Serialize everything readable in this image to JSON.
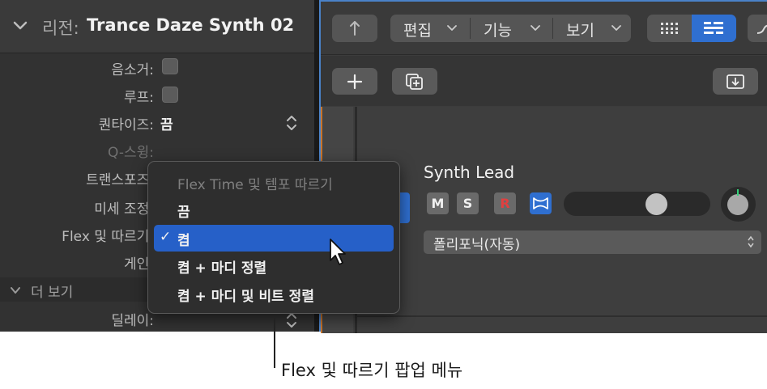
{
  "inspector": {
    "header_label": "리전:",
    "region_name": "Trance Daze Synth 02",
    "rows": {
      "mute": "음소거:",
      "loop": "루프:",
      "quantize": "퀀타이즈:",
      "quantize_value": "끔",
      "q_swing": "Q-스윙:",
      "transpose": "트랜스포즈:",
      "fine_tune": "미세 조정:",
      "flex_follow": "Flex 및 따르기:",
      "gain": "게인:",
      "more": "더 보기",
      "delay": "딜레이:"
    }
  },
  "toolbar": {
    "edit": "편집",
    "functions": "기능",
    "view": "보기"
  },
  "track": {
    "name": "Synth Lead",
    "mute": "M",
    "solo": "S",
    "record": "R",
    "flex_mode": "폴리포닉(자동)",
    "volume_fraction": 0.66
  },
  "popup_menu": {
    "header": "Flex Time 및 템포 따르기",
    "items": [
      "끔",
      "켬",
      "켬 + 마디 정렬",
      "켬 + 마디 및 비트 정렬"
    ],
    "selected": "켬",
    "checkmark": "✓"
  },
  "callout": "Flex 및 따르기 팝업 메뉴",
  "colors": {
    "accent": "#2660c8",
    "record": "#e04040",
    "selection_border": "#4a82c8"
  }
}
